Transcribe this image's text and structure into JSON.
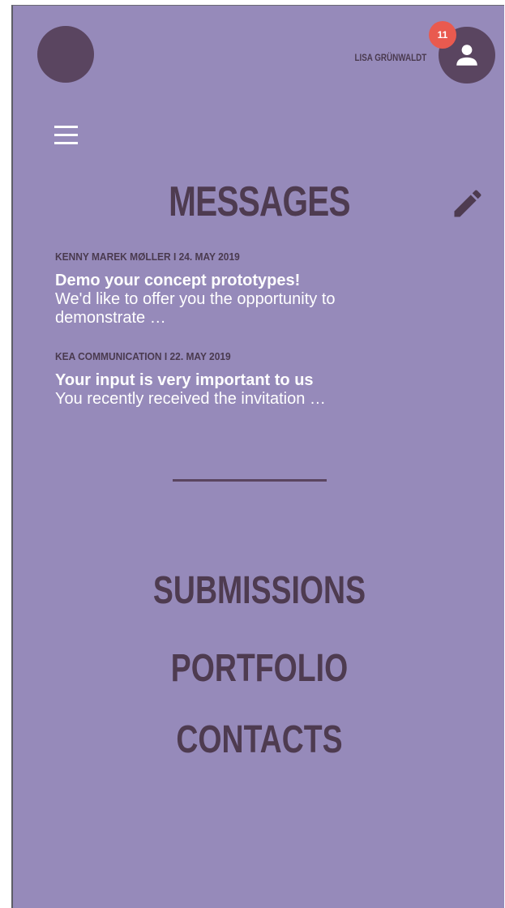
{
  "header": {
    "user_name": "LISA GRÜNWALDT",
    "notification_count": "11"
  },
  "page": {
    "title": "MESSAGES"
  },
  "messages": [
    {
      "meta": "KENNY MAREK MØLLER I 24. MAY 2019",
      "subject": "Demo your concept prototypes!",
      "preview_line1": "We'd like to offer you the opportunity to",
      "preview_line2": "demonstrate …"
    },
    {
      "meta": "KEA COMMUNICATION I 22. MAY 2019",
      "subject": "Your input is very important to us",
      "preview_line1": "You recently received the invitation …",
      "preview_line2": ""
    }
  ],
  "nav": {
    "submissions": "SUBMISSIONS",
    "portfolio": "PORTFOLIO",
    "contacts": "CONTACTS"
  },
  "icons": {
    "menu": "hamburger-menu-icon",
    "edit": "pencil-icon",
    "user": "person-icon"
  },
  "colors": {
    "background": "#968aba",
    "accent_dark": "#5a4560",
    "text_dark": "#4e3b50",
    "badge": "#e95a4f",
    "text_light": "#ffffff"
  }
}
